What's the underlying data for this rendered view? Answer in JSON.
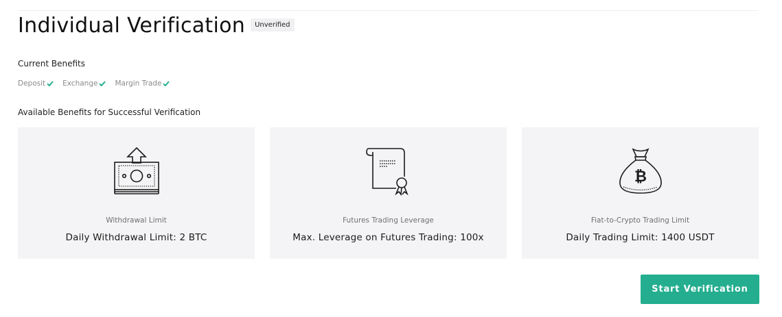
{
  "header": {
    "title": "Individual Verification",
    "status_badge": "Unverified"
  },
  "current_benefits": {
    "label": "Current Benefits",
    "items": [
      {
        "label": "Deposit",
        "icon": "check-icon"
      },
      {
        "label": "Exchange",
        "icon": "check-icon"
      },
      {
        "label": "Margin Trade",
        "icon": "check-icon"
      }
    ],
    "check_color": "#24ae8f"
  },
  "available_benefits": {
    "label": "Available Benefits for Successful Verification",
    "cards": [
      {
        "icon": "cash-withdrawal-icon",
        "label": "Withdrawal Limit",
        "value": "Daily Withdrawal Limit: 2 BTC"
      },
      {
        "icon": "certificate-scroll-icon",
        "label": "Futures Trading Leverage",
        "value": "Max. Leverage on Futures Trading: 100x"
      },
      {
        "icon": "bitcoin-money-bag-icon",
        "label": "Fiat-to-Crypto Trading Limit",
        "value": "Daily Trading Limit: 1400 USDT"
      }
    ]
  },
  "actions": {
    "start_label": "Start Verification",
    "start_color": "#24ae8f"
  }
}
